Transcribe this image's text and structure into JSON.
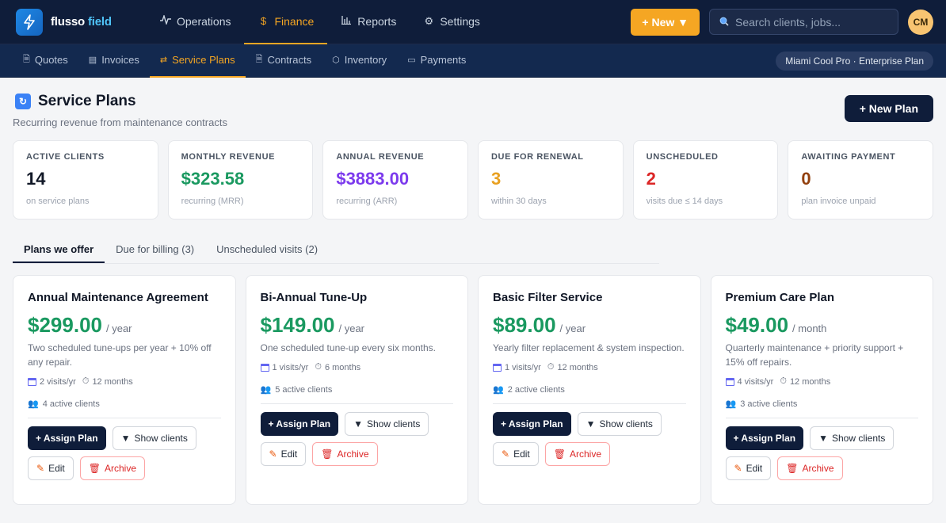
{
  "app": {
    "brand_main": "flusso",
    "brand_accent": "field"
  },
  "topnav": [
    {
      "label": "Operations",
      "icon": "pulse-icon"
    },
    {
      "label": "Finance",
      "icon": "dollar-icon"
    },
    {
      "label": "Reports",
      "icon": "bar-chart-icon"
    },
    {
      "label": "Settings",
      "icon": "gear-icon"
    }
  ],
  "header": {
    "new_label": "+ New ▼",
    "search_placeholder": "Search clients, jobs...",
    "avatar": "CM"
  },
  "subnav": [
    {
      "label": "Quotes",
      "icon": "document-icon"
    },
    {
      "label": "Invoices",
      "icon": "invoice-icon"
    },
    {
      "label": "Service Plans",
      "icon": "repeat-icon"
    },
    {
      "label": "Contracts",
      "icon": "contract-icon"
    },
    {
      "label": "Inventory",
      "icon": "box-icon"
    },
    {
      "label": "Payments",
      "icon": "card-icon"
    }
  ],
  "org_badge": "Miami Cool Pro · Enterprise Plan",
  "page": {
    "title": "Service Plans",
    "subtitle": "Recurring revenue from maintenance contracts",
    "new_plan": "+ New Plan"
  },
  "kpis": [
    {
      "label": "ACTIVE CLIENTS",
      "value": "14",
      "sub": "on service plans",
      "color": "#111827"
    },
    {
      "label": "MONTHLY REVENUE",
      "value": "$323.58",
      "sub": "recurring (MRR)",
      "color": "#1a9960"
    },
    {
      "label": "ANNUAL REVENUE",
      "value": "$3883.00",
      "sub": "recurring (ARR)",
      "color": "#7c3aed"
    },
    {
      "label": "DUE FOR RENEWAL",
      "value": "3",
      "sub": "within 30 days",
      "color": "#e8a020"
    },
    {
      "label": "UNSCHEDULED",
      "value": "2",
      "sub": "visits due ≤ 14 days",
      "color": "#dc2626"
    },
    {
      "label": "AWAITING PAYMENT",
      "value": "0",
      "sub": "plan invoice unpaid",
      "color": "#92400e"
    }
  ],
  "tabs": [
    "Plans we offer",
    "Due for billing (3)",
    "Unscheduled visits (2)"
  ],
  "plans": [
    {
      "name": "Annual Maintenance Agreement",
      "price": "$299.00",
      "period": "/ year",
      "desc": "Two scheduled tune-ups per year + 10% off any repair.",
      "visits": "2 visits/yr",
      "term": "12 months",
      "clients": "4 active clients"
    },
    {
      "name": "Bi-Annual Tune-Up",
      "price": "$149.00",
      "period": "/ year",
      "desc": "One scheduled tune-up every six months.",
      "visits": "1 visits/yr",
      "term": "6 months",
      "clients": "5 active clients"
    },
    {
      "name": "Basic Filter Service",
      "price": "$89.00",
      "period": "/ year",
      "desc": "Yearly filter replacement & system inspection.",
      "visits": "1 visits/yr",
      "term": "12 months",
      "clients": "2 active clients"
    },
    {
      "name": "Premium Care Plan",
      "price": "$49.00",
      "period": "/ month",
      "desc": "Quarterly maintenance + priority support + 15% off repairs.",
      "visits": "4 visits/yr",
      "term": "12 months",
      "clients": "3 active clients"
    }
  ],
  "plan_actions": {
    "assign": "+ Assign Plan",
    "show": "Show clients",
    "edit": "Edit",
    "archive": "Archive"
  }
}
